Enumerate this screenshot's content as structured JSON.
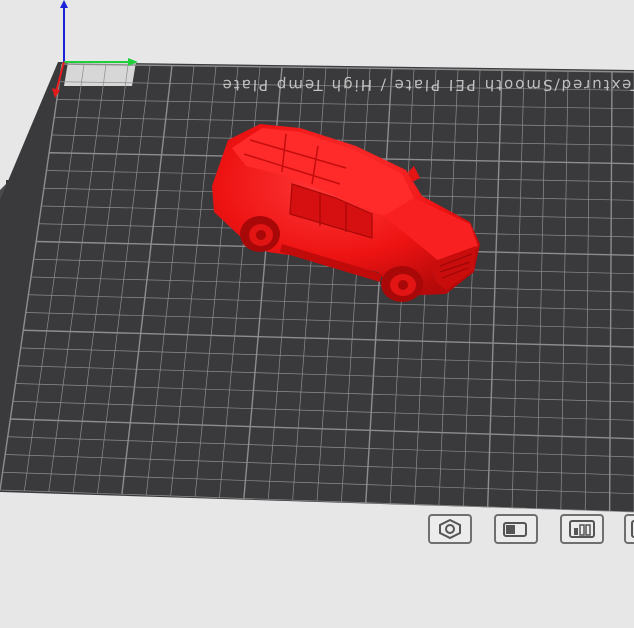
{
  "viewport": {
    "bed_label": "Textured/Smooth PEI Plate / High Temp Plate",
    "model_name": "SUV model",
    "colors": {
      "background": "#e7e7e7",
      "plate": "#3a3a3c",
      "grid": "#8d8d8f",
      "model": "#f21515",
      "axis_x": "#e51a1a",
      "axis_y": "#1fcf3a",
      "axis_z": "#1a23d6"
    }
  },
  "toolbar": {
    "buttons": [
      {
        "name": "orient-icon"
      },
      {
        "name": "camera-view-icon"
      },
      {
        "name": "layout-icon"
      },
      {
        "name": "more-tools-icon"
      }
    ]
  }
}
